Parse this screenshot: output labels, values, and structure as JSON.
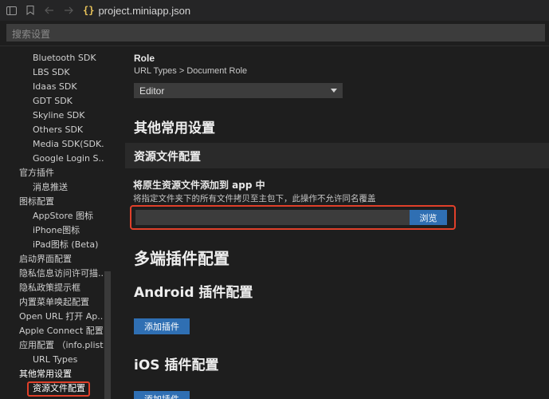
{
  "titlebar": {
    "file_icon_glyph": "{}",
    "filename": "project.miniapp.json"
  },
  "search": {
    "placeholder": "搜索设置"
  },
  "sidebar": {
    "items": [
      {
        "label": "Bluetooth SDK",
        "level": 2
      },
      {
        "label": "LBS SDK",
        "level": 2
      },
      {
        "label": "Idaas SDK",
        "level": 2
      },
      {
        "label": "GDT SDK",
        "level": 2
      },
      {
        "label": "Skyline SDK",
        "level": 2
      },
      {
        "label": "Others SDK",
        "level": 2
      },
      {
        "label": "Media SDK(SDK...",
        "level": 2
      },
      {
        "label": "Google Login S...",
        "level": 2
      },
      {
        "label": "官方插件",
        "level": 1
      },
      {
        "label": "消息推送",
        "level": 2
      },
      {
        "label": "图标配置",
        "level": 1
      },
      {
        "label": "AppStore 图标",
        "level": 2
      },
      {
        "label": "iPhone图标",
        "level": 2
      },
      {
        "label": "iPad图标 (Beta)",
        "level": 2
      },
      {
        "label": "启动界面配置",
        "level": 1
      },
      {
        "label": "隐私信息访问许可描...",
        "level": 1
      },
      {
        "label": "隐私政策提示框",
        "level": 1
      },
      {
        "label": "内置菜单唤起配置",
        "level": 1
      },
      {
        "label": "Open URL 打开 Ap...",
        "level": 1
      },
      {
        "label": "Apple Connect 配置",
        "level": 1
      },
      {
        "label": "应用配置 （info.plist...",
        "level": 1
      },
      {
        "label": "URL Types",
        "level": 2
      },
      {
        "label": "其他常用设置",
        "level": 1
      },
      {
        "label": "资源文件配置",
        "level": 2,
        "active": true
      }
    ]
  },
  "content": {
    "role_label": "Role",
    "role_path": "URL Types > Document Role",
    "role_select_value": "Editor",
    "other_settings_heading": "其他常用设置",
    "resource_section_heading": "资源文件配置",
    "add_resource_title": "将原生资源文件添加到 app 中",
    "add_resource_desc": "将指定文件夹下的所有文件拷贝至主包下，此操作不允许同名覆盖",
    "browse_label": "浏览",
    "multi_plugin_heading": "多端插件配置",
    "android_plugin_heading": "Android 插件配置",
    "android_add_plugin_label": "添加插件",
    "ios_plugin_heading": "iOS 插件配置",
    "ios_add_plugin_label": "添加插件"
  },
  "colors": {
    "background": "#1e1e1e",
    "accent_button": "#2f6fb3",
    "highlight_outline": "#e0402a"
  }
}
